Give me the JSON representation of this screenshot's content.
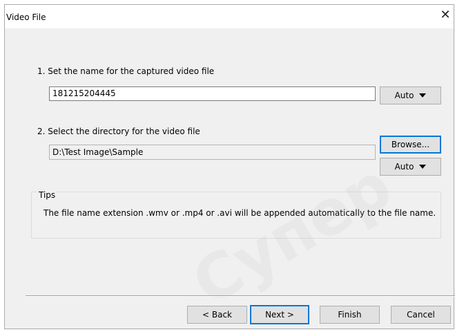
{
  "window": {
    "title": "Video File",
    "close_glyph": "✕"
  },
  "step1": {
    "label": "1. Set the name for the captured video file",
    "filename_value": "181215204445",
    "auto_button_label": "Auto"
  },
  "step2": {
    "label": "2. Select the directory for the video file",
    "directory_value": "D:\\Test Image\\Sample",
    "browse_button_label": "Browse...",
    "auto_button_label": "Auto"
  },
  "tips": {
    "heading": "Tips",
    "text": "The file name extension .wmv or .mp4 or .avi will be appended automatically to the file name."
  },
  "footer": {
    "back_label": "< Back",
    "next_label": "Next >",
    "finish_label": "Finish",
    "cancel_label": "Cancel"
  },
  "watermark": {
    "text": "Супер"
  },
  "colors": {
    "dialog_bg": "#f0f0f0",
    "focus_accent": "#0078d7",
    "button_bg": "#e1e1e1"
  }
}
